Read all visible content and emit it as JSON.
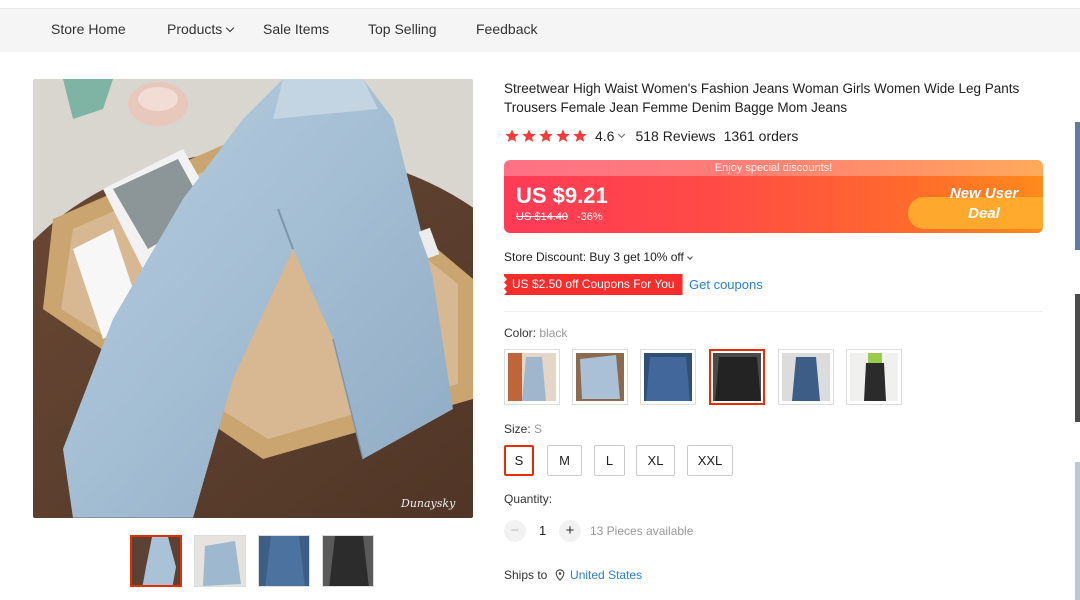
{
  "nav": {
    "items": [
      {
        "label": "Store Home"
      },
      {
        "label": "Products",
        "has_dropdown": true
      },
      {
        "label": "Sale Items"
      },
      {
        "label": "Top Selling"
      },
      {
        "label": "Feedback"
      }
    ]
  },
  "product": {
    "title": "Streetwear High Waist Women's Fashion Jeans Woman Girls Women Wide Leg Pants Trousers Female Jean Femme Denim Bagge Mom Jeans",
    "rating": "4.6",
    "reviews": "518 Reviews",
    "orders": "1361 orders",
    "star_count": 5,
    "image_watermark": "Dunaysky"
  },
  "price": {
    "banner_strip": "Enjoy special discounts!",
    "current": "US $9.21",
    "original": "US $14.40",
    "discount": "-36%",
    "deal_line1": "New User",
    "deal_line2": "Deal"
  },
  "promotions": {
    "store_discount": "Store Discount: Buy 3 get 10% off",
    "coupon_tag": "US $2.50 off Coupons For You",
    "get_coupons": "Get coupons"
  },
  "color": {
    "label": "Color:",
    "selected": "black",
    "option_count": 6,
    "selected_index": 3
  },
  "size": {
    "label": "Size:",
    "selected": "S",
    "options": [
      "S",
      "M",
      "L",
      "XL",
      "XXL"
    ]
  },
  "quantity": {
    "label": "Quantity:",
    "minus": "−",
    "plus": "+",
    "value": "1",
    "available": "13 Pieces available"
  },
  "shipping": {
    "label": "Ships to",
    "country": "United States"
  },
  "thumbnails": {
    "count": 4,
    "selected_index": 0
  },
  "colors": {
    "accent_red": "#e62e04",
    "price_gradient_start": "#ff3a57",
    "price_gradient_end": "#ff8a1c",
    "link_blue": "#2a7fd4",
    "star_color": "#f03c3c"
  }
}
